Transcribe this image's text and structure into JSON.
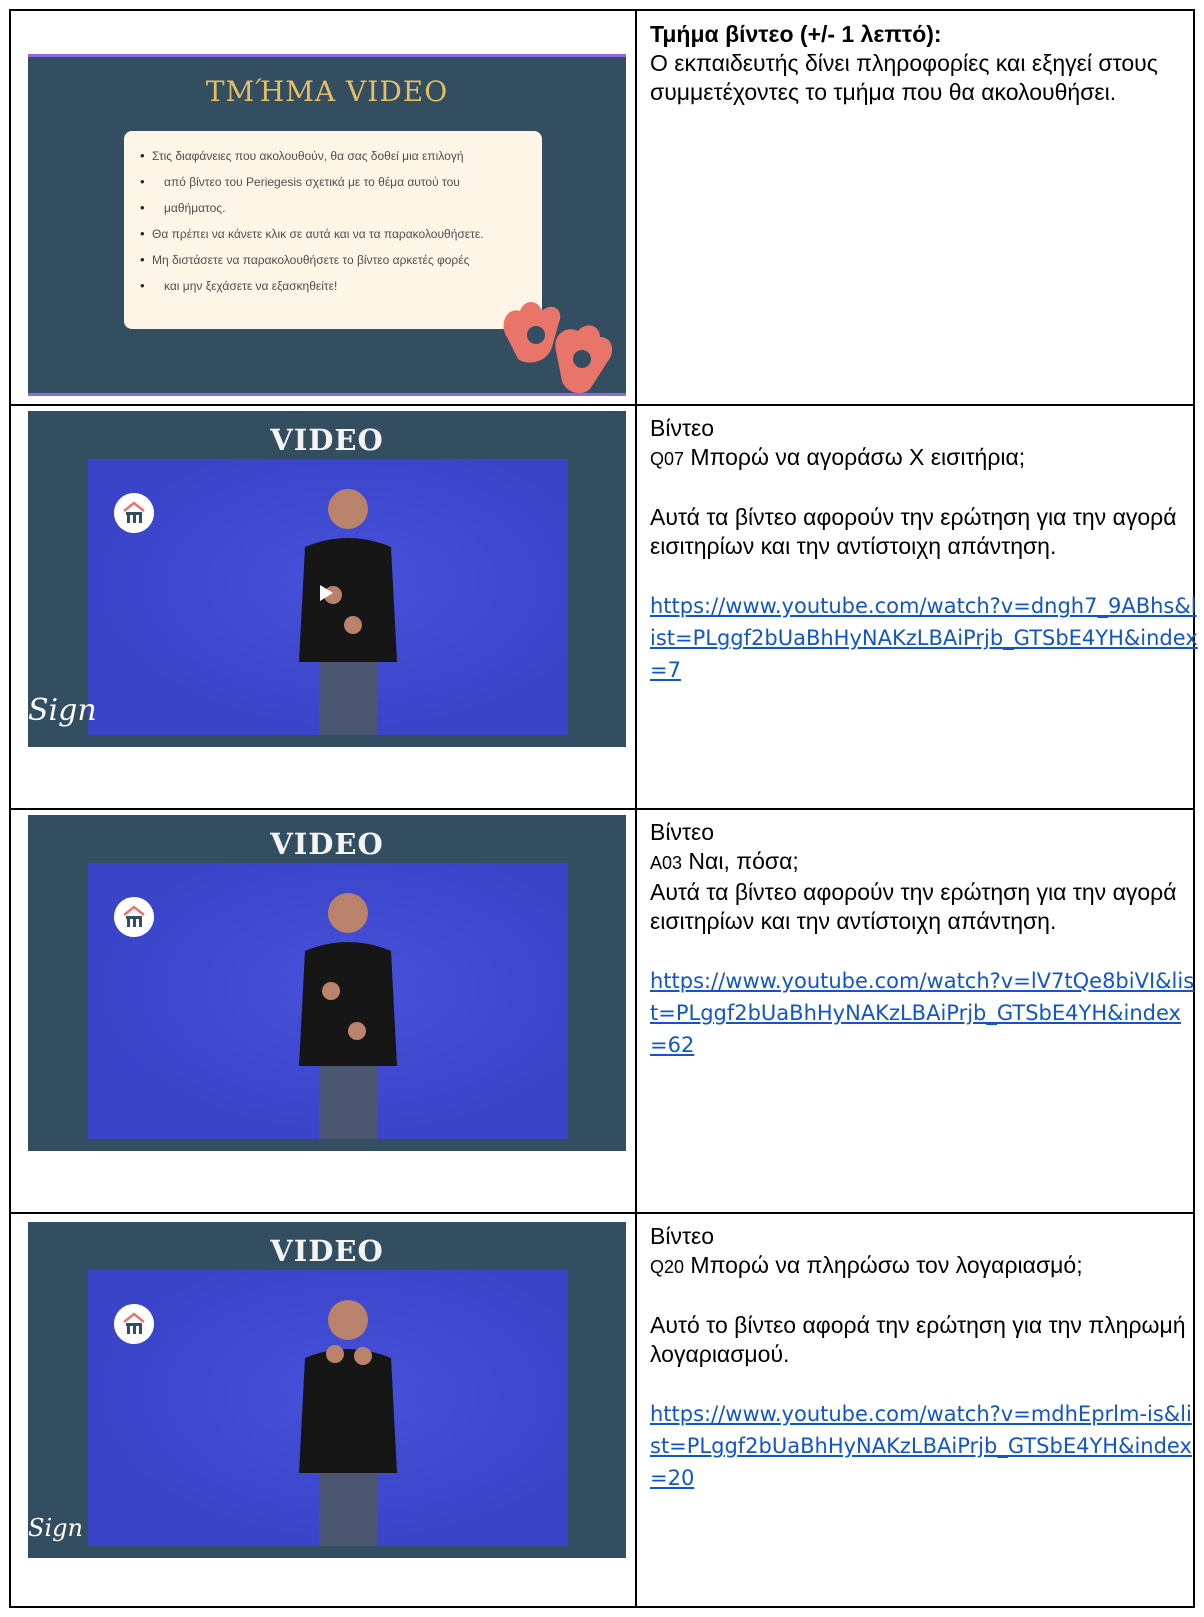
{
  "row1": {
    "slide": {
      "title": "ΤΜΉΜΑ VIDEO",
      "bullets": [
        "Στις διαφάνειες που ακολουθούν, θα σας δοθεί μια επιλογή",
        "από βίντεο του Periegesis σχετικά με το θέμα αυτού του",
        "μαθήματος.",
        "Θα πρέπει να κάνετε κλικ σε αυτά και να τα παρακολουθήσετε.",
        "Μη διστάσετε να παρακολουθήσετε το βίντεο αρκετές φορές",
        "και μην ξεχάσετε να εξασκηθείτε!"
      ]
    },
    "heading": "Τμήμα βίντεο (+/- 1 λεπτό):",
    "body": "Ο εκπαιδευτής δίνει πληροφορίες και εξηγεί στους συμμετέχοντες το τμήμα που θα ακολουθήσει."
  },
  "rows": [
    {
      "slide_title": "VIDEO",
      "corner_text": "Sign",
      "label": "Βίντεο",
      "code": "Q07",
      "question": " Μπορώ να αγοράσω Χ εισιτήρια;",
      "description": "Αυτά τα βίντεο αφορούν την ερώτηση για την αγορά εισιτηρίων και την αντίστοιχη απάντηση.",
      "link": "https://www.youtube.com/watch?v=dngh7_9ABhs&list=PLggf2bUaBhHyNAKzLBAiPrjb_GTSbE4YH&index=7"
    },
    {
      "slide_title": "VIDEO",
      "label": "Βίντεο",
      "code": "A03",
      "question": " Ναι, πόσα;",
      "description": "Αυτά τα βίντεο αφορούν την ερώτηση για την αγορά εισιτηρίων και την αντίστοιχη απάντηση.",
      "link": "https://www.youtube.com/watch?v=lV7tQe8biVI&list=PLggf2bUaBhHyNAKzLBAiPrjb_GTSbE4YH&index=62"
    },
    {
      "slide_title": "VIDEO",
      "corner_text": "Sign",
      "label": "Βίντεο",
      "code": "Q20",
      "question": " Μπορώ να πληρώσω τον λογαριασμό;",
      "description": "Αυτό το βίντεο αφορά την ερώτηση για την πληρωμή λογαριασμού.",
      "link": "https://www.youtube.com/watch?v=mdhEprlm-is&list=PLggf2bUaBhHyNAKzLBAiPrjb_GTSbE4YH&index=20"
    }
  ],
  "colors": {
    "slide_bg": "#344e61",
    "title_gold": "#e6bd62",
    "video_blue": "#3a44c9",
    "link": "#1155cc"
  }
}
